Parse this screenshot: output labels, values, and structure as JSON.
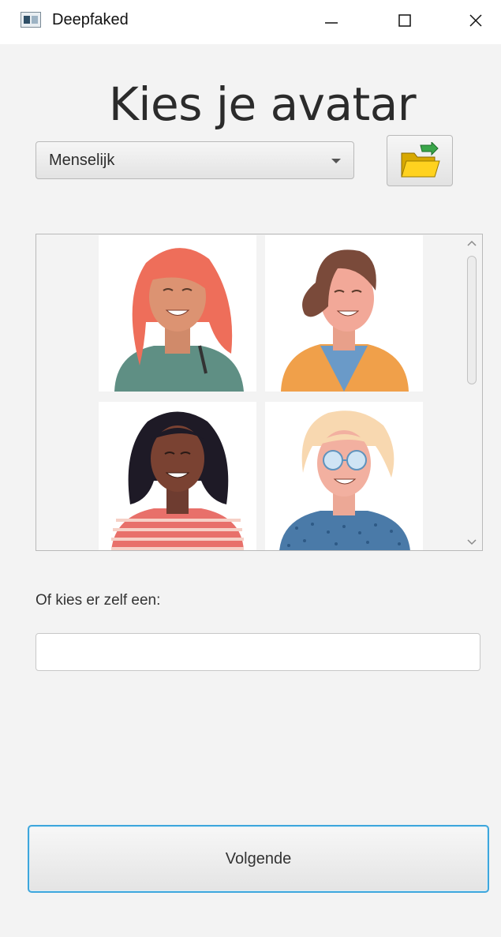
{
  "window": {
    "title": "Deepfaked",
    "controls": {
      "minimize": "minimize-icon",
      "maximize": "maximize-icon",
      "close": "close-icon"
    }
  },
  "main": {
    "heading": "Kies je avatar",
    "category_dropdown": {
      "selected": "Menselijk"
    },
    "folder_button": {
      "icon": "folder-icon"
    },
    "avatars": [
      {
        "icon": "avatar-red-hair-woman"
      },
      {
        "icon": "avatar-brown-hair-woman"
      },
      {
        "icon": "avatar-dark-curly-hair-woman"
      },
      {
        "icon": "avatar-blonde-glasses-woman"
      }
    ],
    "custom_label": "Of kies er zelf een:",
    "custom_input": {
      "value": "",
      "placeholder": ""
    },
    "next_button": "Volgende"
  },
  "colors": {
    "background": "#f3f3f3",
    "accent_border": "#3ea6dc"
  }
}
